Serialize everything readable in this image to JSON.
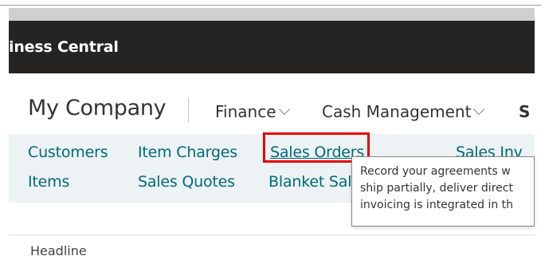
{
  "app": {
    "title": "iness Central"
  },
  "navigation": {
    "company": "My Company",
    "menus": [
      {
        "label": "Finance"
      },
      {
        "label": "Cash Management"
      },
      {
        "label": "S"
      }
    ]
  },
  "links": [
    {
      "label": "Customers"
    },
    {
      "label": "Item Charges"
    },
    {
      "label": "Sales Orders"
    },
    {
      "label": "Sales Inv"
    },
    {
      "label": "Items"
    },
    {
      "label": "Sales Quotes"
    },
    {
      "label": "Blanket Sale"
    }
  ],
  "tooltip": {
    "lines": [
      "Record your agreements w",
      "ship partially, deliver direct",
      "invoicing is integrated in th"
    ]
  },
  "content": {
    "headline": "Headline"
  },
  "colors": {
    "appbar": "#252423",
    "link": "#006a7d",
    "highlight": "#e60000",
    "links_band": "#edf2f4"
  }
}
